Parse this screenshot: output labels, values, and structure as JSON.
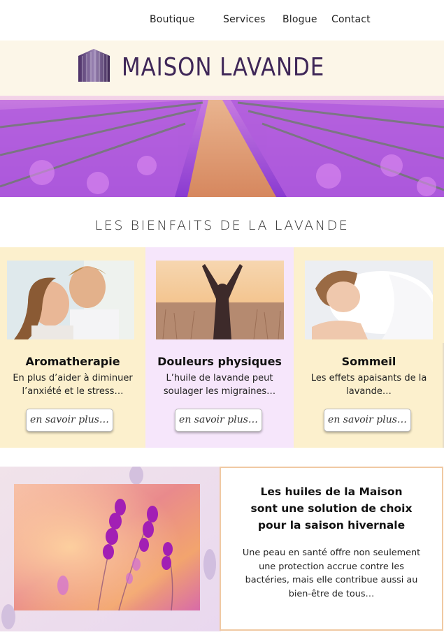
{
  "nav": {
    "items": [
      {
        "label": "Boutique"
      },
      {
        "label": "Services"
      },
      {
        "label": "Blogue"
      },
      {
        "label": "Contact"
      }
    ]
  },
  "brand": {
    "name": "MAISON LAVANDE",
    "color": "#3f2758",
    "background": "#fcf6e8"
  },
  "hero": {
    "image": "lavender-field-photo"
  },
  "section": {
    "title": "LES BIENFAITS DE LA LAVANDE"
  },
  "cards": [
    {
      "title": "Aromatherapie",
      "text": "En plus d’aider à diminuer l’anxiété et le stress…",
      "button": "en savoir plus…",
      "image": "couple-breathing-photo",
      "background": "#fcf0cd"
    },
    {
      "title": "Douleurs physiques",
      "text": "L’huile de lavande peut soulager les migraines…",
      "button": "en savoir plus…",
      "image": "woman-arms-raised-photo",
      "background": "#f6e6fb"
    },
    {
      "title": "Sommeil",
      "text": "Les effets apaisants de la lavande…",
      "button": "en savoir plus…",
      "image": "woman-sleeping-photo",
      "background": "#fcf0cd"
    }
  ],
  "promo": {
    "title": "Les huiles de la Maison sont une solution de choix pour la saison hivernale",
    "text": "Une peau en santé offre non seulement une protection accrue contre les bactéries, mais elle contribue aussi au bien-être de tous…",
    "image": "lavender-closeup-photo",
    "border_color": "#f0c9a3"
  }
}
